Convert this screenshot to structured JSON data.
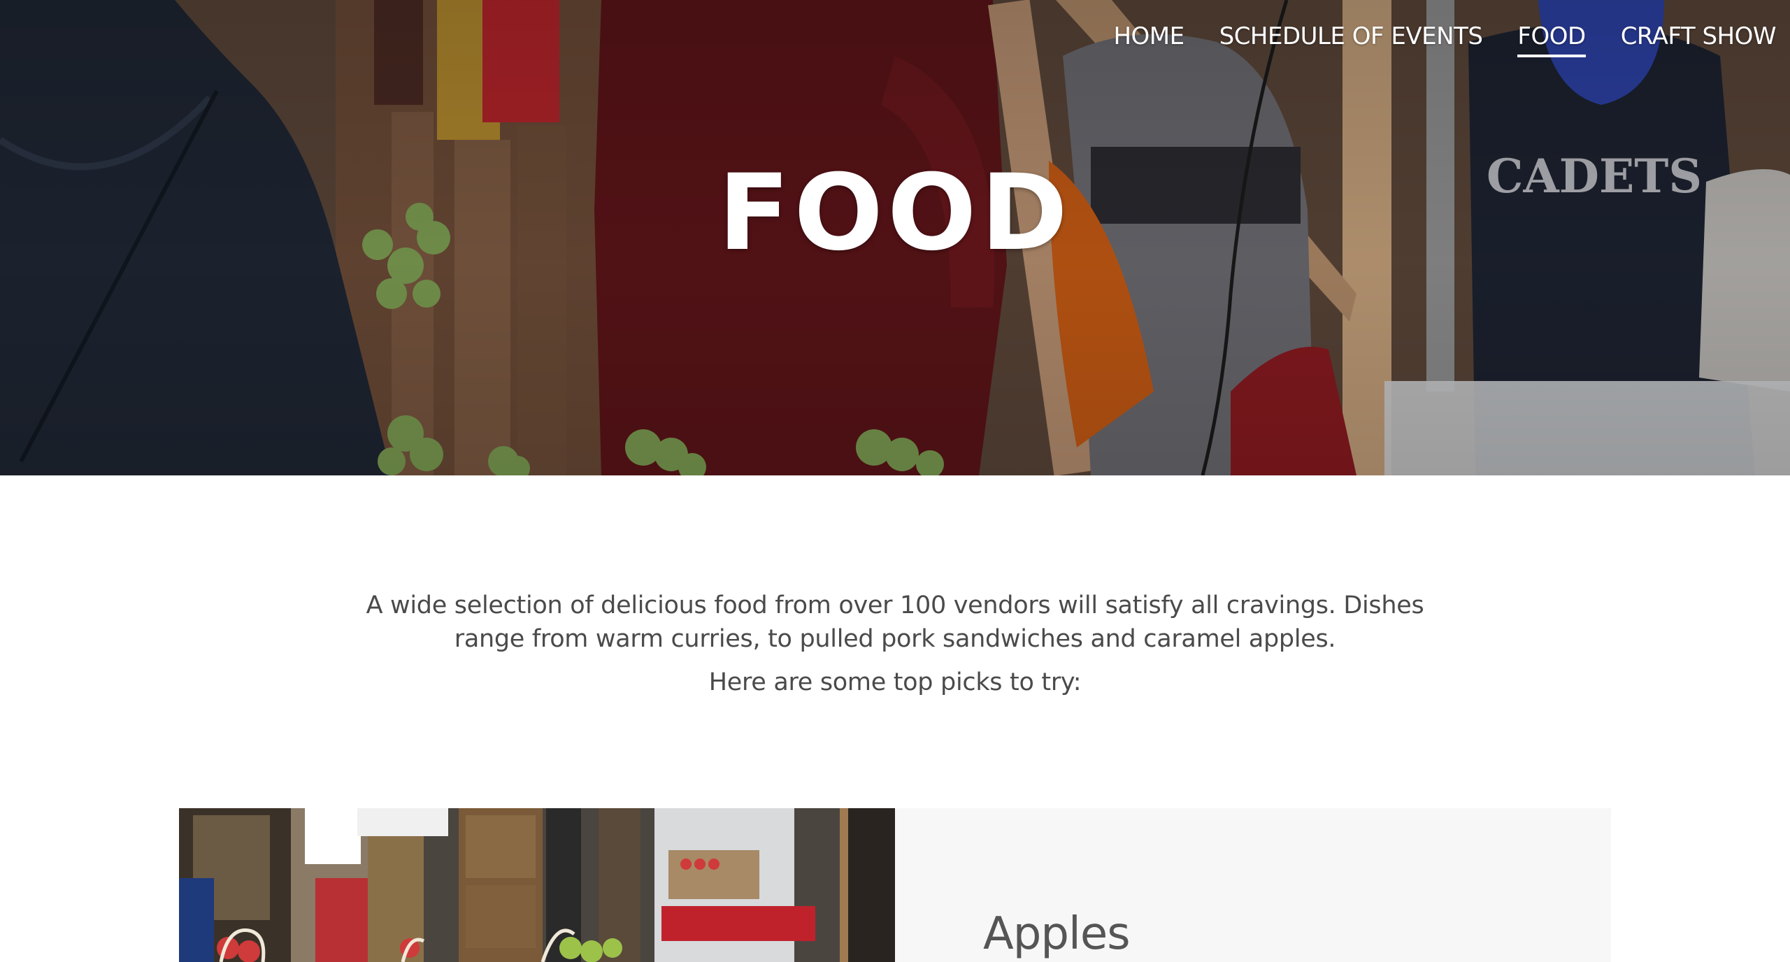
{
  "nav": {
    "items": [
      {
        "label": "HOME",
        "active": false
      },
      {
        "label": "SCHEDULE OF EVENTS",
        "active": false
      },
      {
        "label": "FOOD",
        "active": true
      },
      {
        "label": "CRAFT SHOW",
        "active": false
      }
    ]
  },
  "hero": {
    "title": "FOOD"
  },
  "intro": {
    "text": "A wide selection of delicious food from over 100 vendors will satisfy all cravings. Dishes range from warm curries, to pulled pork sandwiches and caramel apples.",
    "picks": "Here are some top picks to try:"
  },
  "cards": [
    {
      "title": "Apples"
    }
  ],
  "colors": {
    "text": "#4a4a4a",
    "card_panel": "#f7f7f7",
    "nav_text": "#ffffff"
  }
}
